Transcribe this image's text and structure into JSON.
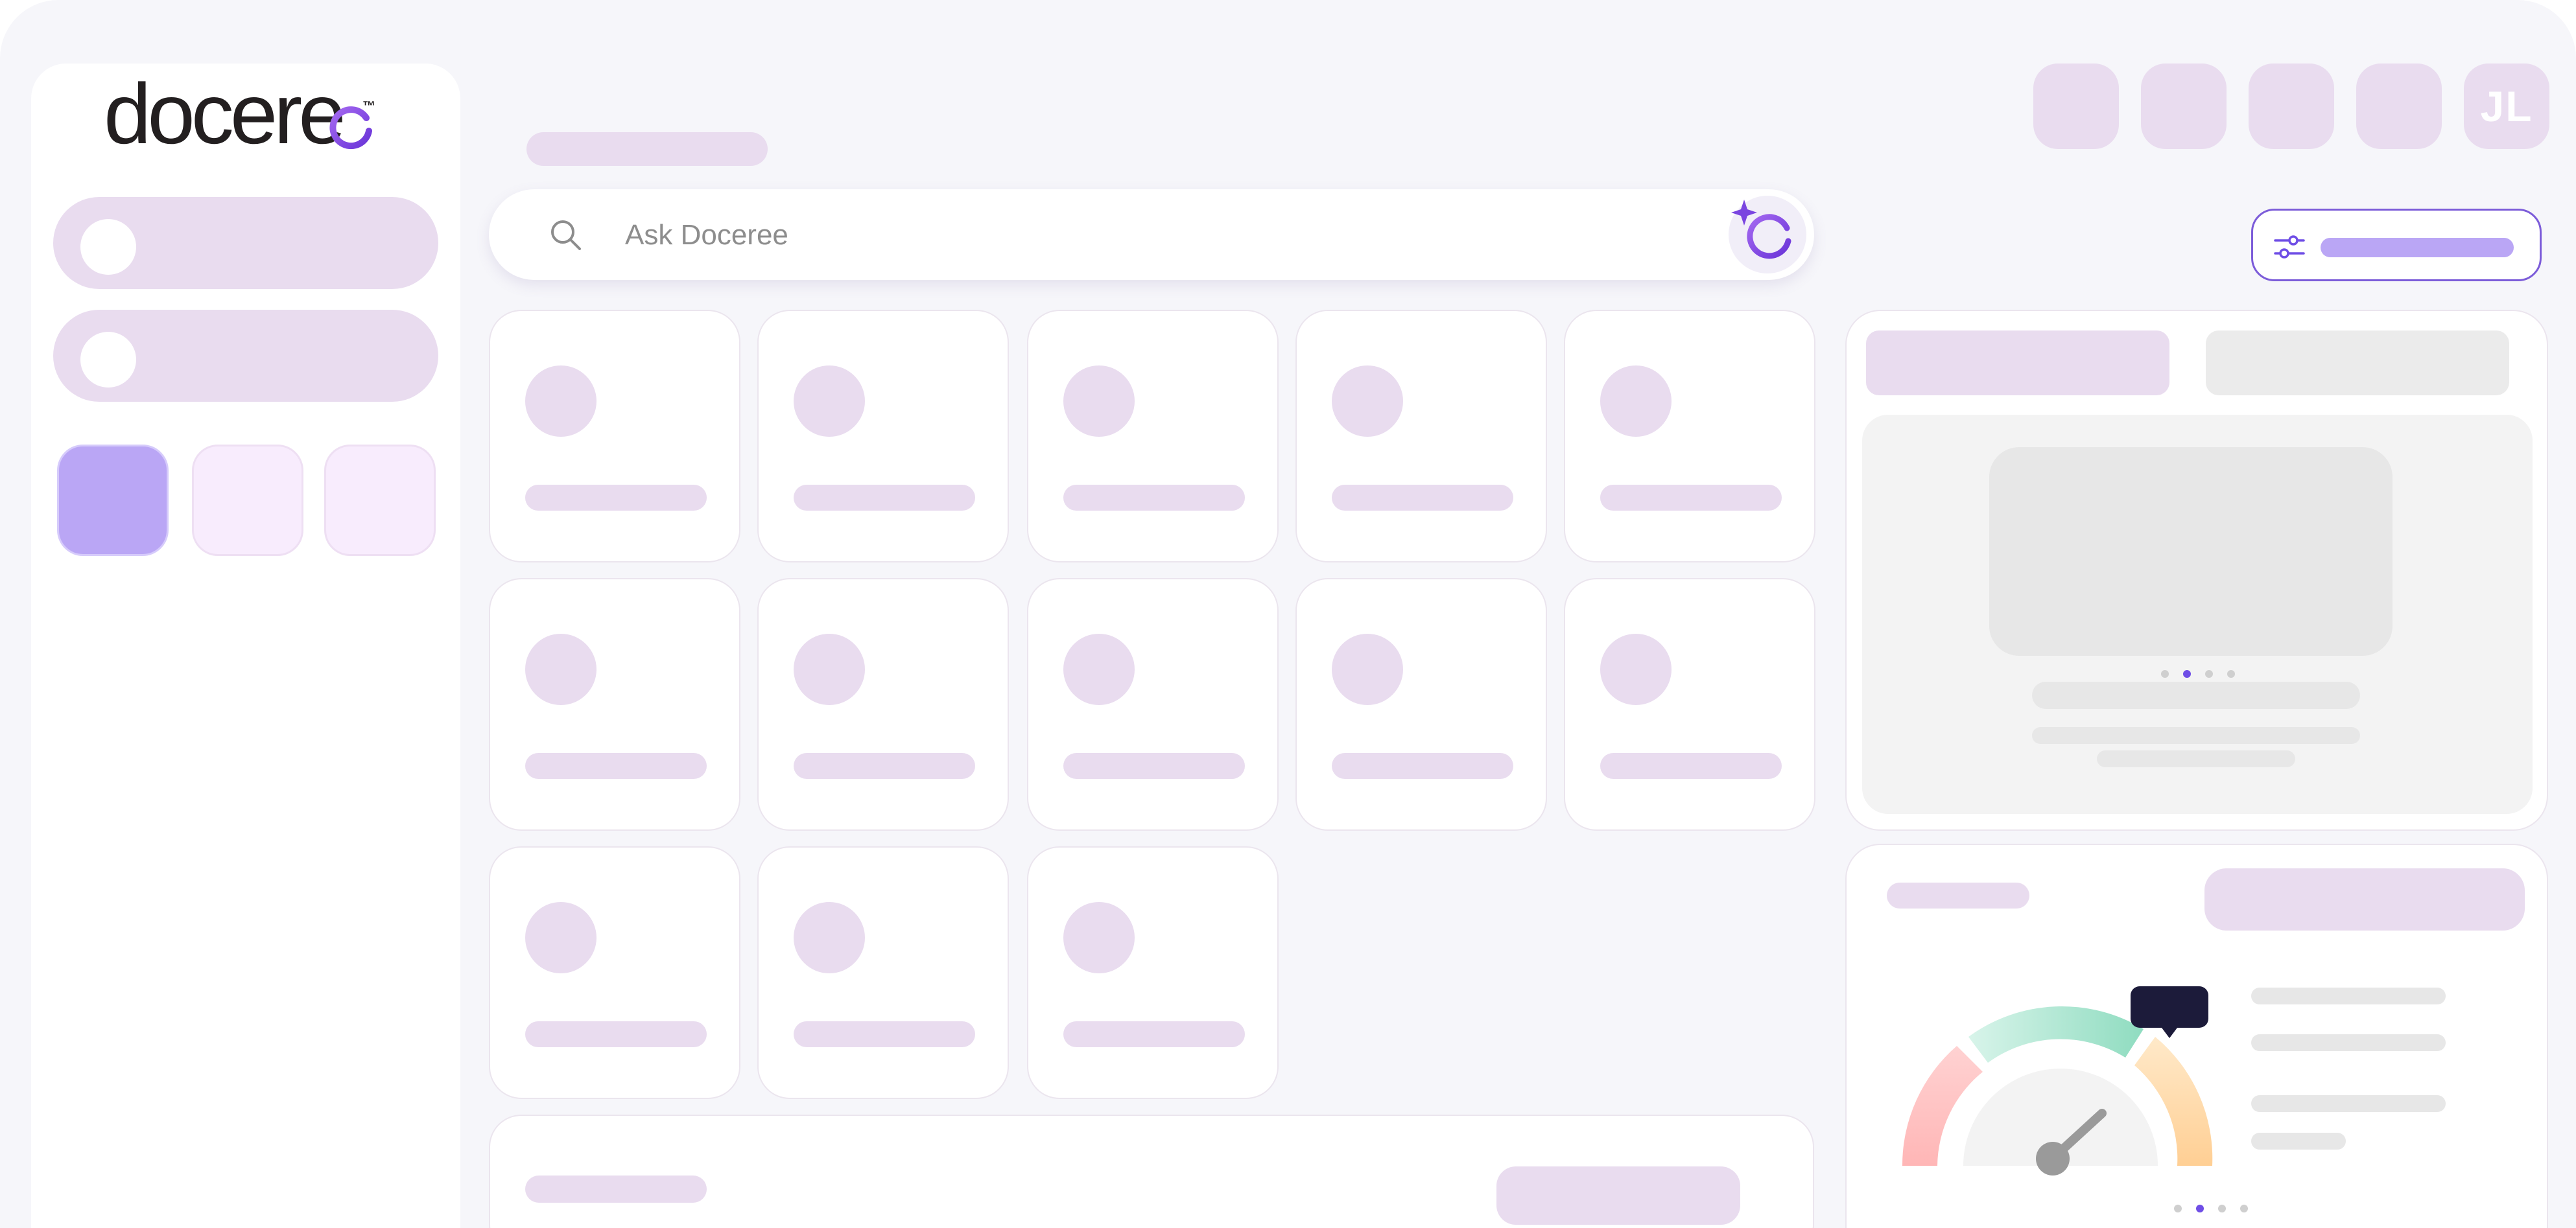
{
  "app": {
    "logo_text": "docere",
    "logo_tm": "™"
  },
  "search": {
    "placeholder": "Ask Doceree",
    "value": ""
  },
  "header": {
    "avatar_initials": "JL"
  },
  "carousel": {
    "slide_count": 4,
    "active_slide": 2
  },
  "gauge_carousel": {
    "slide_count": 4,
    "active_slide": 2
  },
  "icons": {
    "search": "search-icon",
    "ai_assistant": "sparkle-logo-icon",
    "filter": "sliders-icon",
    "gauge": "gauge-icon"
  },
  "colors": {
    "accent": "#7c5cd9",
    "skeleton": "#e9dcef",
    "active_tile": "#baa6f5",
    "background": "#f6f6fa"
  }
}
